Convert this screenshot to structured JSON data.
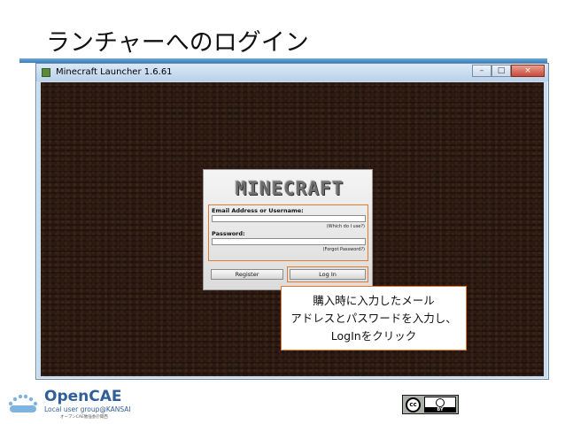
{
  "slide": {
    "title": "ランチャーへのログイン"
  },
  "window": {
    "title": "Minecraft Launcher 1.6.61",
    "controls": {
      "minimize": "–",
      "maximize": "□",
      "close": "×"
    }
  },
  "login_panel": {
    "logo_text": "MINECRAFT",
    "email_label": "Email Address or Username:",
    "email_value": "",
    "email_hint": "(Which do I use?)",
    "password_label": "Password:",
    "password_value": "",
    "password_hint": "(Forgot Password?)",
    "register_button": "Register",
    "login_button": "Log In"
  },
  "callout": {
    "lines": [
      "購入時に入力したメール",
      "アドレスとパスワードを入力し、",
      "LogInをクリック"
    ]
  },
  "footer": {
    "brand_name": "OpenCAE",
    "brand_sub": "Local user group@KANSAI",
    "brand_sub2": "オープンCAE勉強会＠関西",
    "license": {
      "cc": "cc",
      "by": "BY"
    }
  },
  "colors": {
    "accent_orange": "#e27a2f",
    "title_rule_blue": "#3d7fb8",
    "brand_blue": "#2f5f9a"
  }
}
